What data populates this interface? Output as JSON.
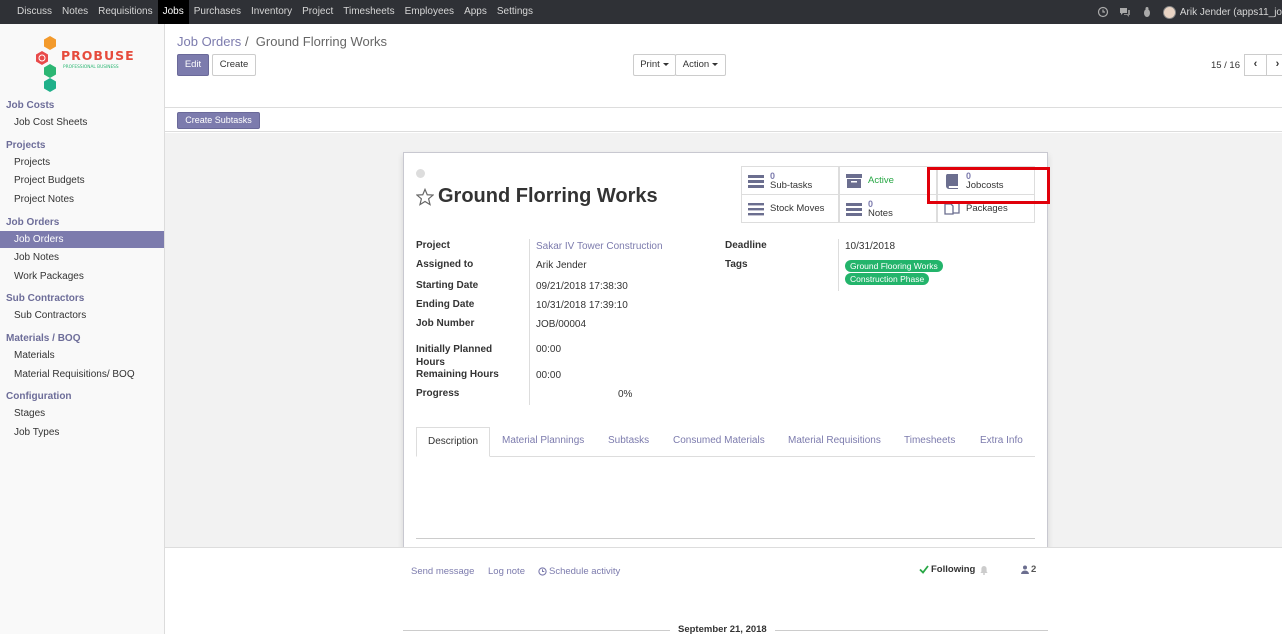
{
  "topbar": {
    "menu": [
      "Discuss",
      "Notes",
      "Requisitions",
      "Jobs",
      "Purchases",
      "Inventory",
      "Project",
      "Timesheets",
      "Employees",
      "Apps",
      "Settings"
    ],
    "active": "Jobs",
    "user": "Arik Jender (apps11_jo"
  },
  "logo": {
    "brand": "PROBUSE",
    "tagline": "PROFESSIONAL BUSINESS"
  },
  "sidebar": {
    "sections": [
      {
        "title": "Job Costs",
        "items": [
          "Job Cost Sheets"
        ]
      },
      {
        "title": "Projects",
        "items": [
          "Projects",
          "Project Budgets",
          "Project Notes"
        ]
      },
      {
        "title": "Job Orders",
        "items": [
          "Job Orders",
          "Job Notes",
          "Work Packages"
        ]
      },
      {
        "title": "Sub Contractors",
        "items": [
          "Sub Contractors"
        ]
      },
      {
        "title": "Materials / BOQ",
        "items": [
          "Materials",
          "Material Requisitions/ BOQ"
        ]
      },
      {
        "title": "Configuration",
        "items": [
          "Stages",
          "Job Types"
        ]
      }
    ],
    "active_item": "Job Orders"
  },
  "breadcrumb": {
    "parent": "Job Orders",
    "separator": "/",
    "current": "Ground Florring Works"
  },
  "buttons": {
    "edit": "Edit",
    "create": "Create",
    "print": "Print",
    "action": "Action",
    "create_subtasks": "Create Subtasks"
  },
  "pager": {
    "value": "15 / 16",
    "prev": "‹",
    "next": "›"
  },
  "record": {
    "title": "Ground Florring Works",
    "smart_buttons": {
      "subtasks": {
        "count": "0",
        "label": "Sub-tasks"
      },
      "active": {
        "label": "Active"
      },
      "jobcosts": {
        "count": "0",
        "label": "Jobcosts"
      },
      "stock_moves": {
        "label": "Stock Moves"
      },
      "notes": {
        "count": "0",
        "label": "Notes"
      },
      "packages": {
        "label": "Packages"
      }
    },
    "fields_left": [
      {
        "label": "Project",
        "value": "Sakar IV Tower Construction"
      },
      {
        "label": "Assigned to",
        "value": "Arik Jender"
      },
      {
        "label": "Starting Date",
        "value": "09/21/2018 17:38:30"
      },
      {
        "label": "Ending Date",
        "value": "10/31/2018 17:39:10"
      },
      {
        "label": "Job Number",
        "value": "JOB/00004"
      },
      {
        "label": "Initially Planned Hours",
        "value": "00:00"
      },
      {
        "label": "Remaining Hours",
        "value": "00:00"
      },
      {
        "label": "Progress",
        "value": "0%"
      }
    ],
    "deadline": {
      "label": "Deadline",
      "value": "10/31/2018"
    },
    "tags": {
      "label": "Tags",
      "items": [
        "Ground Flooring Works",
        "Construction Phase"
      ]
    },
    "tabs": [
      "Description",
      "Material Plannings",
      "Subtasks",
      "Consumed Materials",
      "Material Requisitions",
      "Timesheets",
      "Extra Info"
    ]
  },
  "chatter": {
    "send_message": "Send message",
    "log_note": "Log note",
    "schedule_activity": "Schedule activity",
    "following": "Following",
    "followers_count": "2",
    "date": "September 21, 2018"
  },
  "colors": {
    "brand": "#7c7bad",
    "topbar": "#2f3136",
    "tag": "#23b46b",
    "highlight": "#e0000a"
  }
}
